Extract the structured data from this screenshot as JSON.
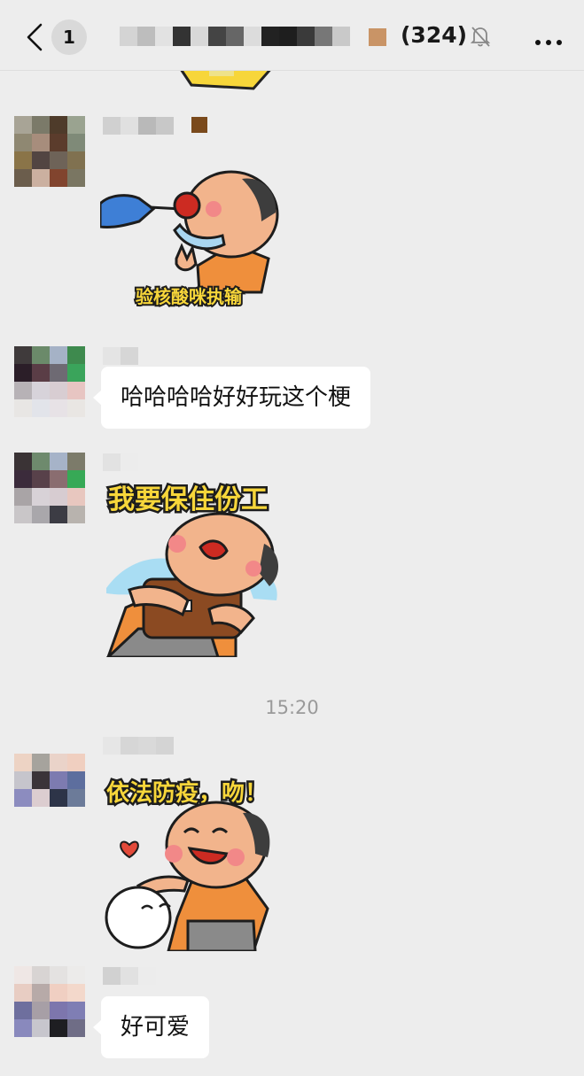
{
  "header": {
    "back_icon": "chevron-left-icon",
    "unread_count": "1",
    "member_count": "(324)",
    "mute_icon": "bell-slash-icon",
    "more_icon": "ellipsis-icon"
  },
  "messages": [
    {
      "type": "sticker",
      "caption": "验核酸咪执输"
    },
    {
      "type": "text",
      "text": "哈哈哈哈好好玩这个梗"
    },
    {
      "type": "sticker",
      "caption": "我要保住份工"
    },
    {
      "type": "timestamp",
      "text": "15:20"
    },
    {
      "type": "sticker",
      "caption": "依法防疫，吻！"
    },
    {
      "type": "text",
      "text": "好可爱"
    }
  ],
  "colors": {
    "background": "#ededed",
    "bubble": "#ffffff",
    "timestamp": "#9a9a9a",
    "sticker_skin": "#f2b48c",
    "sticker_shirt": "#ef8f3c",
    "sticker_caption": "#f7d63a"
  }
}
